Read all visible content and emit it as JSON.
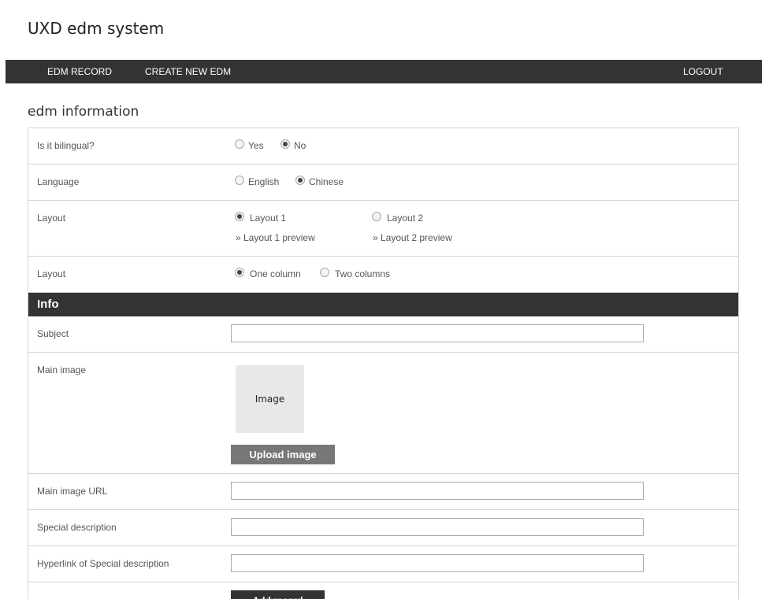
{
  "app": {
    "title": "UXD edm system"
  },
  "nav": {
    "edm_record": "EDM RECORD",
    "create_new_edm": "CREATE NEW EDM",
    "logout": "LOGOUT"
  },
  "section": {
    "title": "edm information"
  },
  "form": {
    "bilingual": {
      "label": "Is it bilingual?",
      "options": [
        {
          "label": "Yes",
          "checked": false
        },
        {
          "label": "No",
          "checked": true
        }
      ]
    },
    "language": {
      "label": "Language",
      "options": [
        {
          "label": "English",
          "checked": false
        },
        {
          "label": "Chinese",
          "checked": true
        }
      ]
    },
    "layout": {
      "label": "Layout",
      "options": [
        {
          "label": "Layout 1",
          "checked": true,
          "preview": "» Layout 1 preview"
        },
        {
          "label": "Layout 2",
          "checked": false,
          "preview": "» Layout 2 preview"
        }
      ]
    },
    "columns": {
      "label": "Layout",
      "options": [
        {
          "label": "One column",
          "checked": true
        },
        {
          "label": "Two columns",
          "checked": false
        }
      ]
    }
  },
  "info": {
    "header": "Info",
    "subject": {
      "label": "Subject",
      "value": ""
    },
    "main_image": {
      "label": "Main image",
      "placeholder_text": "Image",
      "upload_label": "Upload image"
    },
    "main_image_url": {
      "label": "Main image URL",
      "value": ""
    },
    "special_description": {
      "label": "Special description",
      "value": ""
    },
    "special_description_link": {
      "label": "Hyperlink of Special description",
      "value": ""
    },
    "add_record_label": "Add record"
  }
}
